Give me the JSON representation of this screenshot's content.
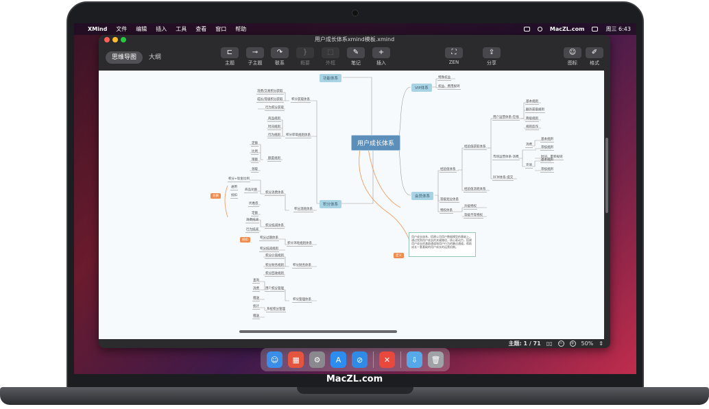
{
  "menubar": {
    "apple_icon": "",
    "app_name": "XMind",
    "items": [
      "文件",
      "编辑",
      "插入",
      "工具",
      "查看",
      "窗口",
      "帮助"
    ],
    "site": "MacZL.com",
    "clock": "周三 6:43"
  },
  "window": {
    "title": "用户成长体系xmind模板.xmind"
  },
  "toolbar": {
    "view_mindmap": "思维导图",
    "view_outline": "大纲",
    "tools": [
      {
        "label": "主题",
        "icon": "topic-icon",
        "glyph": "⊏"
      },
      {
        "label": "子主题",
        "icon": "subtopic-icon",
        "glyph": "⊸"
      },
      {
        "label": "联系",
        "icon": "relationship-icon",
        "glyph": "↷"
      },
      {
        "label": "概要",
        "icon": "summary-icon",
        "glyph": "}"
      },
      {
        "label": "外框",
        "icon": "boundary-icon",
        "glyph": "⬚"
      },
      {
        "label": "笔记",
        "icon": "note-icon",
        "glyph": "✎"
      },
      {
        "label": "插入",
        "icon": "insert-icon",
        "glyph": "+"
      },
      {
        "label": "ZEN",
        "icon": "zen-icon",
        "glyph": "⛶"
      },
      {
        "label": "分享",
        "icon": "share-icon",
        "glyph": "⇪"
      },
      {
        "label": "图标",
        "icon": "sticker-icon",
        "glyph": "☺"
      },
      {
        "label": "格式",
        "icon": "format-icon",
        "glyph": "✐"
      }
    ]
  },
  "mindmap": {
    "central": "用户成长体系",
    "branches": {
      "function": "功能体系",
      "vip": "VIP体系",
      "member": "会员体系",
      "points": "积分体系"
    },
    "vip_children": [
      "特殊权益",
      "权益、费用规则"
    ],
    "member_children": {
      "growth": "经验值体系",
      "growth_sub1": "经验值获取体系",
      "growth_sub2": "经验值消耗体系",
      "user_status": "用户运营体系-在线",
      "basic_rule": "基本规则",
      "extra_rule": "额外获取规则",
      "decay_rule": "降级规则",
      "anti_cheat": "规则反作",
      "market": "市场运营体系-消费",
      "consume": "消费",
      "basic_rule2": "基本规则",
      "audit_rule": "审核规则",
      "time_rule": "时间、累积规则",
      "recharge": "充值",
      "basic_rule3": "基本规则",
      "audit_rule2": "审核规则",
      "rfm": "RFM体系-提交",
      "level_design": "等级划分体系",
      "privilege": "特权体系",
      "basic_priv": "升级特权",
      "paid_priv": "等级不等特权"
    },
    "points_children": {
      "acquire": "积分获取体系",
      "acquire_1": "消费/交易积分获取",
      "acquire_2": "成长/等级积分获取",
      "acquire_3": "行为积分获取",
      "rule_sys": "积分获取规则体系",
      "rule_1": "商品规则",
      "rule_2": "时间规则",
      "rule_3": "行为规则",
      "rule_4": "额度规则",
      "r_a": "定额",
      "r_b": "比例",
      "r_c": "限额",
      "r_d": "领取",
      "consume_sys": "积分消耗体系",
      "exchange": "积分消费体系",
      "ex_1": "积分+现金比例",
      "ex_2": "商品兑换",
      "ex_3": "通用",
      "ex_4": "抵扣",
      "ex_5": "优惠券",
      "ex_6": "定额",
      "ex_7": "积分抵减体系",
      "ex_8": "消费抵减",
      "ex_9": "行为抵减",
      "overdue": "积分过期体系",
      "overdue_rule": "积分消耗规则体系",
      "overdue_2": "积分抵减规则",
      "finance": "积分财务体系",
      "fin_1": "积分价值规则",
      "fin_2": "积分财务规则",
      "fin_3": "积分回收规则",
      "manage": "积分管理体系",
      "user_manage": "用户积分管理",
      "um_1": "查询",
      "um_2": "消费",
      "um_3": "赠送",
      "sys_manage": "系统积分管理",
      "sm_1": "统计",
      "sm_2": "赠送"
    },
    "orange_tags": [
      "兑换",
      "抵扣",
      "定义"
    ],
    "note_text": "用户成长体系，搭建公司用户数据模型的基础上，通过找到用户成长的关键路径，核心驱动力，搭建用户成长的激励通道和用户行为的触达通道，帮助成长一套基础的用户成长的运营机制。"
  },
  "status": {
    "topics": "主题: 1 / 71",
    "zoom": "50%",
    "zoom_out": "−",
    "zoom_in": "+"
  },
  "dock": {
    "apps": [
      {
        "name": "finder",
        "color": "#3a8ee8",
        "glyph": "☺"
      },
      {
        "name": "launchpad",
        "color": "#e4553f",
        "glyph": "▦"
      },
      {
        "name": "system-preferences",
        "color": "#8a8a8e",
        "glyph": "⚙"
      },
      {
        "name": "app-store",
        "color": "#2d8cf0",
        "glyph": "A"
      },
      {
        "name": "safari",
        "color": "#2f8be6",
        "glyph": "⊘"
      },
      {
        "name": "xmind",
        "color": "#e8493c",
        "glyph": "✕"
      },
      {
        "name": "downloads",
        "color": "#56a8e8",
        "glyph": "⇩"
      },
      {
        "name": "trash",
        "color": "#9fa2a6",
        "glyph": "🗑"
      }
    ]
  },
  "brand": "MacZL.com"
}
